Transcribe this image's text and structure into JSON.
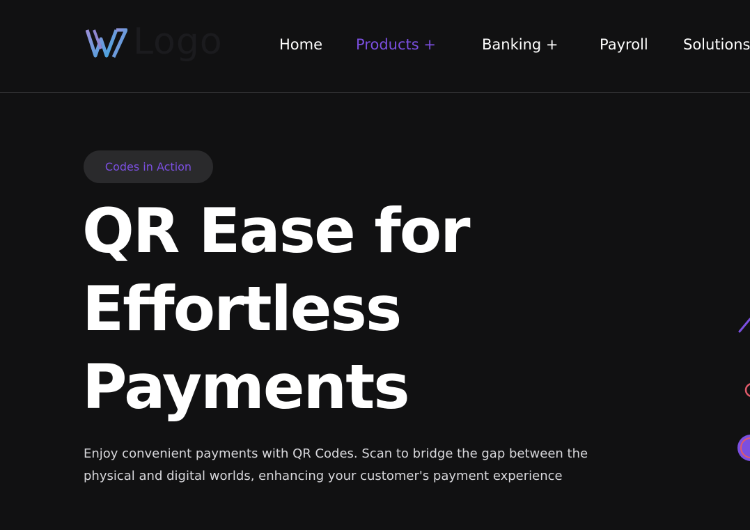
{
  "header": {
    "logo_text": "Logo",
    "nav": [
      {
        "label": "Home",
        "active": false
      },
      {
        "label": "Products +",
        "active": true
      },
      {
        "label": "Banking +",
        "active": false
      },
      {
        "label": "Payroll",
        "active": false
      },
      {
        "label": "Solutions",
        "active": false
      }
    ]
  },
  "hero": {
    "badge": "Codes in Action",
    "headline_lines": [
      "QR Ease for",
      "Effortless",
      "Payments"
    ],
    "description_lines": [
      "Enjoy convenient payments with QR Codes. Scan to bridge the gap between the",
      "physical and digital worlds, enhancing your customer's payment experience"
    ]
  },
  "colors": {
    "background": "#111112",
    "accent": "#7b4fe0",
    "text": "#ffffff",
    "badge_bg": "#2a2a2c",
    "divider": "#3a3a3c"
  },
  "icons": [
    "logo-mark-icon",
    "decorative-arrow-icon",
    "decorative-pin-icon",
    "decorative-circle-icon"
  ]
}
